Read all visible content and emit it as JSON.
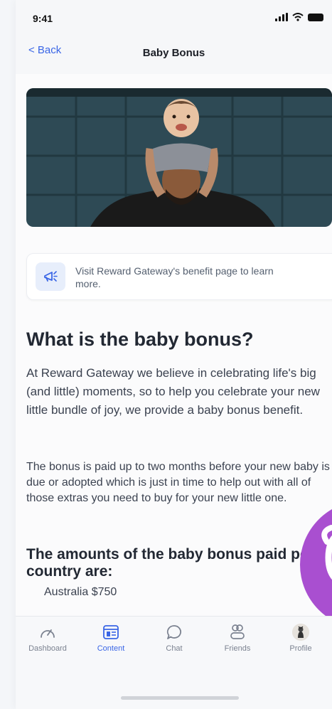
{
  "status_bar": {
    "time": "9:41"
  },
  "nav": {
    "back_label": "< Back",
    "title": "Baby Bonus"
  },
  "info_card": {
    "text": "Visit Reward Gateway's benefit page to learn more."
  },
  "article": {
    "heading": "What is the baby bonus?",
    "paragraph1": "At Reward Gateway we believe in celebrating life's big (and little) moments, so to help you celebrate your new little bundle of joy, we provide a baby bonus benefit.",
    "paragraph2": "The bonus is paid up to two months before your new baby is due or adopted which is just in time to help out with all of those extras you need to buy for your new little one.",
    "subheading": "The amounts of the baby bonus paid per country are:",
    "list_peek": "Australia $750"
  },
  "tabs": [
    {
      "label": "Dashboard",
      "icon": "gauge-icon",
      "active": false
    },
    {
      "label": "Content",
      "icon": "content-icon",
      "active": true
    },
    {
      "label": "Chat",
      "icon": "chat-bubble-icon",
      "active": false
    },
    {
      "label": "Friends",
      "icon": "friends-icon",
      "active": false
    },
    {
      "label": "Profile",
      "icon": "profile-avatar",
      "active": false
    }
  ],
  "colors": {
    "accent": "#3a66e6",
    "fab": "#a94fd0",
    "background": "#f6f7f9"
  }
}
